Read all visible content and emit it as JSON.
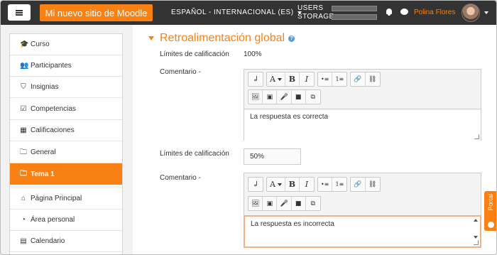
{
  "navbar": {
    "brand": "Mi nuevo sitio de Moodle",
    "language": "ESPAÑOL - INTERNACIONAL (ES)",
    "usage_users_label": "USERS",
    "usage_storage_label": "STORAGE",
    "users_fraction": 0,
    "storage_fraction": 0,
    "username": "Polina Flores",
    "icons": [
      "menu-icon",
      "bell-icon",
      "chat-icon",
      "caret-down-icon"
    ]
  },
  "sidebar": {
    "items": [
      {
        "label": "Curso",
        "icon": "graduation-cap-icon",
        "glyph": "🎓",
        "active": false
      },
      {
        "label": "Participantes",
        "icon": "users-icon",
        "glyph": "👥",
        "active": false
      },
      {
        "label": "Insignias",
        "icon": "shield-icon",
        "glyph": "⛉",
        "active": false
      },
      {
        "label": "Competencias",
        "icon": "checkbox-icon",
        "glyph": "☑",
        "active": false
      },
      {
        "label": "Calificaciones",
        "icon": "table-icon",
        "glyph": "▦",
        "active": false
      },
      {
        "label": "General",
        "icon": "folder-icon",
        "glyph": "🗀",
        "active": false
      },
      {
        "label": "Tema 1",
        "icon": "folder-icon",
        "glyph": "🗀",
        "active": true
      },
      {
        "label": "Página Principal",
        "icon": "home-icon",
        "glyph": "⌂",
        "active": false
      },
      {
        "label": "Área personal",
        "icon": "dashboard-icon",
        "glyph": "◔",
        "active": false
      },
      {
        "label": "Calendario",
        "icon": "calendar-icon",
        "glyph": "▤",
        "active": false
      }
    ]
  },
  "main": {
    "section_title": "Retroalimentación global",
    "help_glyph": "?",
    "feedback": [
      {
        "grade_label": "Límites de calificación",
        "grade_value": "100%",
        "comment_label": "Comentario -",
        "comment_text": "La respuesta es correcta"
      },
      {
        "grade_label": "Límites de calificación",
        "grade_value": "50%",
        "comment_label": "Comentario -",
        "comment_text": "La respuesta es incorrecta"
      }
    ],
    "toolbar": {
      "row1": [
        "↲",
        "A",
        "B",
        "I",
        "•≡",
        "1≡",
        "🔗",
        "⛓"
      ],
      "row2": [
        "🖼",
        "▣",
        "🎤",
        "■",
        "⧉"
      ]
    }
  },
  "portal": {
    "label": "Portal"
  }
}
